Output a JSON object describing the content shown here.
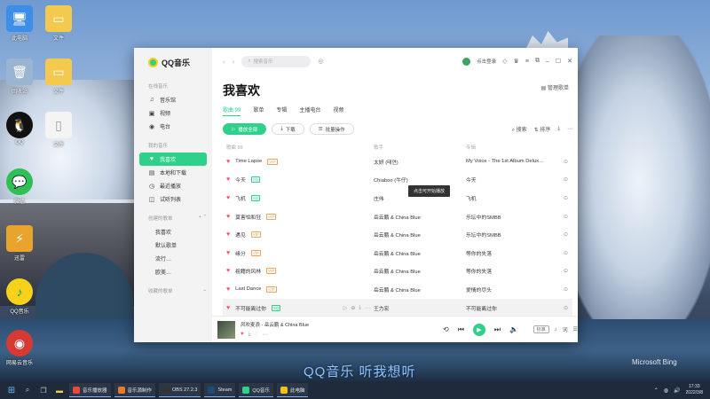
{
  "desktop": {
    "icons": [
      {
        "label": "此电脑",
        "symbol": "🖥",
        "color": "#3c8ee8"
      },
      {
        "label": "回收站",
        "symbol": "🗑",
        "color": "#9bb4d0"
      },
      {
        "label": "QQ",
        "symbol": "🐧",
        "color": "#111111"
      },
      {
        "label": "微信",
        "symbol": "💬",
        "color": "#2fbf55"
      },
      {
        "label": "迅雷",
        "symbol": "⚡",
        "color": "#e8a42c"
      },
      {
        "label": "QQ音乐",
        "symbol": "♪",
        "color": "#f7d21b"
      },
      {
        "label": "网易云音乐",
        "symbol": "◉",
        "color": "#d63a33"
      }
    ],
    "folder_labels": [
      "文件",
      "文件",
      "文件"
    ],
    "caption": "QQ音乐 听我想听",
    "bing_label": "Microsoft Bing"
  },
  "app": {
    "logo_text": "QQ音乐",
    "search_placeholder": "搜索音乐",
    "username": "点击登录",
    "page_title": "我喜欢",
    "manage_label": "管理歌单",
    "sidebar": {
      "section_online": "在线音乐",
      "online_items": [
        {
          "icon": "♫",
          "label": "音乐馆"
        },
        {
          "icon": "▣",
          "label": "视频"
        },
        {
          "icon": "◉",
          "label": "电台"
        }
      ],
      "section_mine": "我的音乐",
      "mine_items": [
        {
          "icon": "♥",
          "label": "我喜欢"
        },
        {
          "icon": "▤",
          "label": "本地和下载"
        },
        {
          "icon": "◷",
          "label": "最近播放"
        },
        {
          "icon": "◫",
          "label": "试听列表"
        }
      ],
      "section_created": "创建的歌单",
      "created_items": [
        "我喜欢",
        "默认歌单",
        "流行…",
        "欧美…"
      ],
      "section_collected": "收藏的歌单"
    },
    "tabs": [
      "歌曲 99",
      "歌单",
      "专辑",
      "主播电台",
      "视频"
    ],
    "buttons": {
      "play_all": "播放全部",
      "download": "下载",
      "batch": "批量操作",
      "search": "搜索",
      "sort": "排序"
    },
    "table_headers": [
      "歌曲 99",
      "歌手",
      "专辑",
      ""
    ],
    "songs": [
      {
        "title": "Time Lapse",
        "tag": "VIP",
        "artist": "太妍 (태연)",
        "album": "My Voice - The 1st Album Delux…"
      },
      {
        "title": "今天",
        "tag": "SQ",
        "artist": "Chiaboo (牛仔)",
        "album": "今天"
      },
      {
        "title": "飞机",
        "tag": "SQ",
        "artist": "庄伟",
        "album": "飞机"
      },
      {
        "title": "莫害怕和狂",
        "tag": "VIP",
        "artist": "岳云鹏 & China Blue",
        "album": "乐坛中的SMBB"
      },
      {
        "title": "遇见",
        "tag": "VIP",
        "artist": "岳云鹏 & China Blue",
        "album": "乐坛中的SMBB"
      },
      {
        "title": "缘分",
        "tag": "VIP",
        "artist": "岳云鹏 & China Blue",
        "album": "等你的失落"
      },
      {
        "title": "祖籍的风林",
        "tag": "VIP",
        "artist": "岳云鹏 & China Blue",
        "album": "等你的失落"
      },
      {
        "title": "Last Dance",
        "tag": "VIP",
        "artist": "岳云鹏 & China Blue",
        "album": "爱情的尽头"
      },
      {
        "title": "不可能离过你",
        "tag": "SQ",
        "artist": "王力宏",
        "album": "不可能离过你"
      }
    ],
    "tooltip": "点击可开始播放",
    "player": {
      "now_playing": "风吹麦浪 - 岳云鹏 & China Blue",
      "quality": "标准",
      "volume_label": "音量",
      "list_label": "列表"
    }
  },
  "taskbar": {
    "apps": [
      {
        "label": "音乐播放器",
        "color": "#e84a3c"
      },
      {
        "label": "音乐源制作",
        "color": "#e87a2c"
      },
      {
        "label": "OBS 27.2.3",
        "color": "#333333"
      },
      {
        "label": "Steam",
        "color": "#1b4c7a"
      },
      {
        "label": "QQ音乐",
        "color": "#2fd18a"
      },
      {
        "label": "此电脑",
        "color": "#f2c11b"
      }
    ],
    "time": "17:33",
    "date": "2022/3/8"
  }
}
